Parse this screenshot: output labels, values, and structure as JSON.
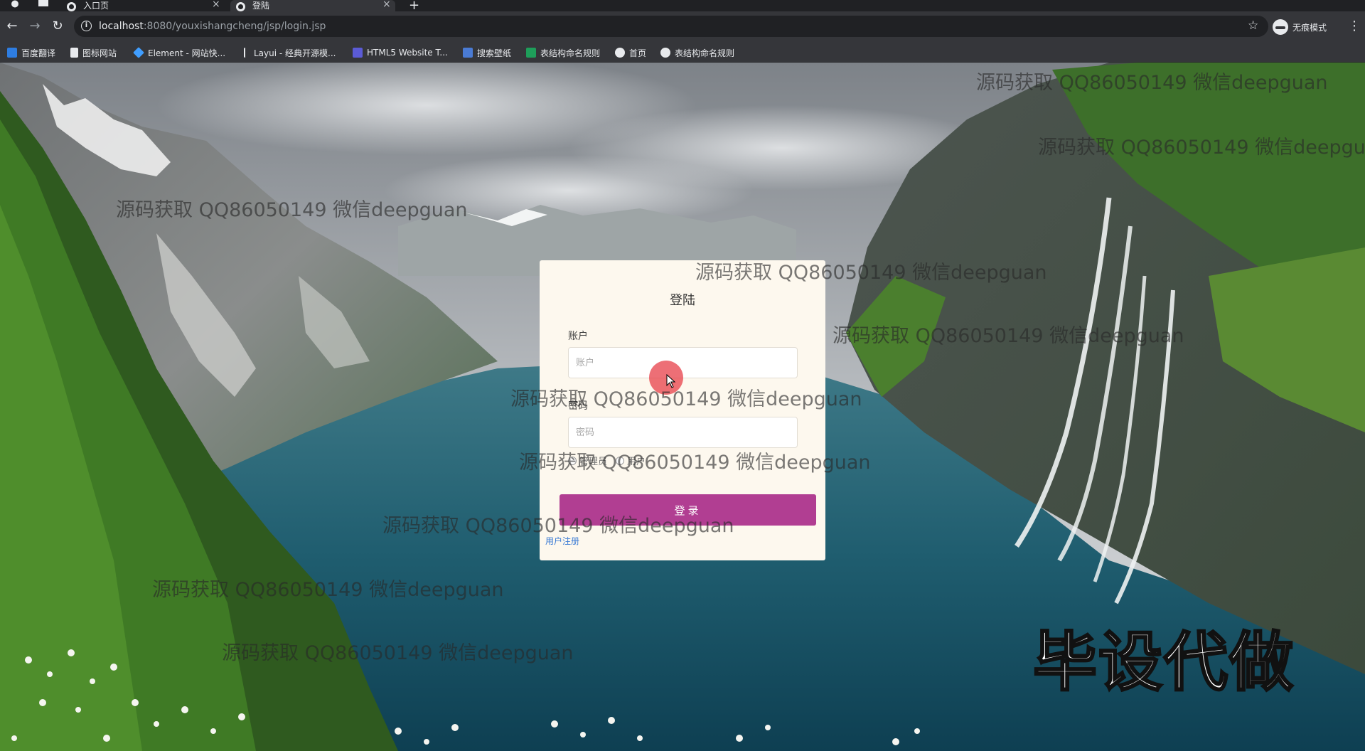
{
  "browser": {
    "tabs": [
      {
        "title": "入口页"
      },
      {
        "title": "登陆"
      }
    ],
    "url_host": "localhost",
    "url_path": ":8080/youxishangcheng/jsp/login.jsp",
    "incognito_label": "无痕模式",
    "bookmarks": [
      {
        "label": "百度翻译",
        "color": "#2e7de1"
      },
      {
        "label": "图标网站",
        "color": "#e8eaed"
      },
      {
        "label": "Element - 网站快...",
        "color": "#409eff"
      },
      {
        "label": "Layui - 经典开源模...",
        "color": "#e8eaed"
      },
      {
        "label": "HTML5 Website T...",
        "color": "#5b5bd6"
      },
      {
        "label": "搜索壁纸",
        "color": "#4a7bd4"
      },
      {
        "label": "表结构命名规则",
        "color": "#1e9e5a"
      },
      {
        "label": "首页",
        "color": "#e8eaed"
      },
      {
        "label": "表结构命名规则",
        "color": "#e8eaed"
      }
    ]
  },
  "login": {
    "title": "登陆",
    "account_label": "账户",
    "account_placeholder": "账户",
    "password_label": "密码",
    "password_placeholder": "密码",
    "role_options": [
      "管理员",
      "用户"
    ],
    "submit_label": "登录",
    "register_link": "用户注册"
  },
  "watermark_text": "源码获取 QQ86050149 微信deepguan",
  "promo_text": "毕设代做",
  "colors": {
    "button": "#b13e92",
    "card": "#fdf8ee",
    "link": "#3a7bd5"
  }
}
